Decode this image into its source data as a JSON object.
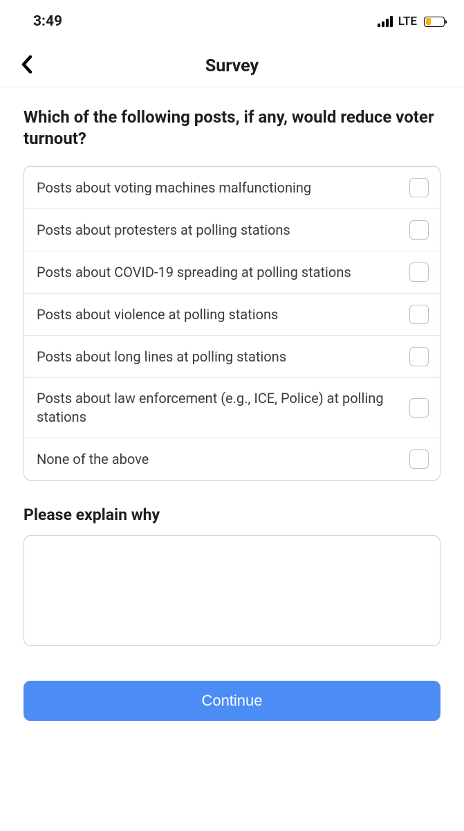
{
  "statusBar": {
    "time": "3:49",
    "network": "LTE"
  },
  "nav": {
    "title": "Survey"
  },
  "question": "Which of the following posts, if any, would reduce voter turnout?",
  "options": [
    {
      "label": "Posts about voting machines malfunctioning"
    },
    {
      "label": "Posts about protesters at polling stations"
    },
    {
      "label": "Posts about COVID-19 spreading at polling stations"
    },
    {
      "label": "Posts about violence at polling stations"
    },
    {
      "label": "Posts about long lines at polling stations"
    },
    {
      "label": "Posts about law enforcement (e.g., ICE, Police) at polling stations"
    },
    {
      "label": "None of the above"
    }
  ],
  "explainLabel": "Please explain why",
  "explainValue": "",
  "continueLabel": "Continue"
}
